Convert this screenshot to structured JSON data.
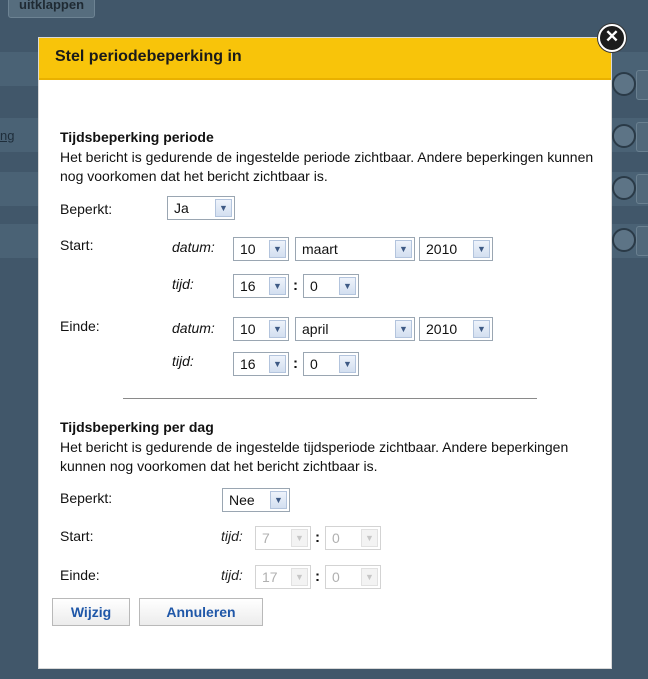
{
  "background": {
    "top_button_label": "uitklappen",
    "link_fragment": "ng"
  },
  "dialog": {
    "title": "Stel periodebeperking in",
    "close_glyph": "✕",
    "period": {
      "heading": "Tijdsbeperking periode",
      "description": "Het bericht is gedurende de ingestelde periode zichtbaar. Andere beperkingen kunnen nog voorkomen dat het bericht zichtbaar is.",
      "restricted_label": "Beperkt:",
      "restricted_value": "Ja",
      "start_label": "Start:",
      "end_label": "Einde:",
      "date_label": "datum:",
      "time_label": "tijd:",
      "start": {
        "day": "10",
        "month": "maart",
        "year": "2010",
        "hour": "16",
        "minute": "0"
      },
      "end": {
        "day": "10",
        "month": "april",
        "year": "2010",
        "hour": "16",
        "minute": "0"
      }
    },
    "daily": {
      "heading": "Tijdsbeperking per dag",
      "description": "Het bericht is gedurende de ingestelde tijdsperiode zichtbaar. Andere beperkingen kunnen nog voorkomen dat het bericht zichtbaar is.",
      "restricted_label": "Beperkt:",
      "restricted_value": "Nee",
      "start_label": "Start:",
      "end_label": "Einde:",
      "time_label": "tijd:",
      "start": {
        "hour": "7",
        "minute": "0"
      },
      "end": {
        "hour": "17",
        "minute": "0"
      }
    },
    "buttons": {
      "apply": "Wijzig",
      "cancel": "Annuleren"
    },
    "colon": ":"
  },
  "colors": {
    "header": "#f8c40a",
    "backdrop": "#41576a",
    "button_text": "#1f57a8"
  }
}
